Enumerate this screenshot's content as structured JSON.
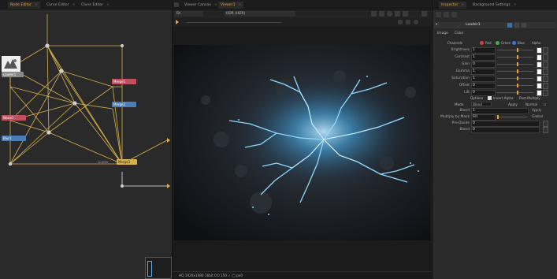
{
  "flow_panel": {
    "tabs": [
      {
        "label": "Node Editor",
        "active": true
      },
      {
        "label": "Curve Editor",
        "active": false
      },
      {
        "label": "Clone Editor",
        "active": false
      }
    ],
    "nodes": [
      "Loader1",
      "Merge1",
      "Merge2",
      "Noise1",
      "Blur1",
      "Merge3"
    ],
    "side_label": "Loader"
  },
  "viewer": {
    "tabs": [
      {
        "label": "Viewer Canvas",
        "active": false
      },
      {
        "label": "Viewer1",
        "active": true
      }
    ],
    "toolbar_left": "Fit",
    "toolbar_mid": "HDR (HDR)",
    "status": "HQ 1920x1080 16bit 0:0 150 ✓ ◯ px0"
  },
  "inspector": {
    "tabs": [
      {
        "label": "Inspector",
        "active": true
      },
      {
        "label": "Background Settings",
        "active": false
      }
    ],
    "title": "Loader1",
    "subtabs": [
      "Image",
      "Color"
    ],
    "channel_label": "Channels",
    "channels": [
      "Red",
      "Green",
      "Blue",
      "Alpha"
    ],
    "sliders": [
      {
        "label": "Brightness",
        "value": "1",
        "level": 0.55
      },
      {
        "label": "Contrast",
        "value": "1",
        "level": 0.55
      },
      {
        "label": "Gain",
        "value": "0",
        "level": 0.55
      },
      {
        "label": "Gamma",
        "value": "1",
        "level": 0.55
      },
      {
        "label": "Saturation",
        "value": "1",
        "level": 0.55
      },
      {
        "label": "Offset",
        "value": "0",
        "level": 0.55
      },
      {
        "label": "Lift",
        "value": "0",
        "level": 0.55
      }
    ],
    "options": {
      "label": "Options",
      "check1": "Invert Alpha",
      "check2": "Post-Multiply"
    },
    "mode": {
      "label": "Mode",
      "value": "Blend",
      "label2": "Apply",
      "value2": "Normal"
    },
    "blend": {
      "label": "Blend",
      "value": "1",
      "right": "Apply"
    },
    "multiply": {
      "label": "Multiply by Mask",
      "value": "Fill",
      "right": "Global"
    },
    "pre_divide": {
      "label": "Pre-Divide",
      "value": "0"
    },
    "blend2": {
      "label": "Blend",
      "value": "0"
    }
  },
  "colors": {
    "accent": "#e6a23c",
    "wire": "#d9b24a",
    "bolt": "#7fd4ff"
  }
}
